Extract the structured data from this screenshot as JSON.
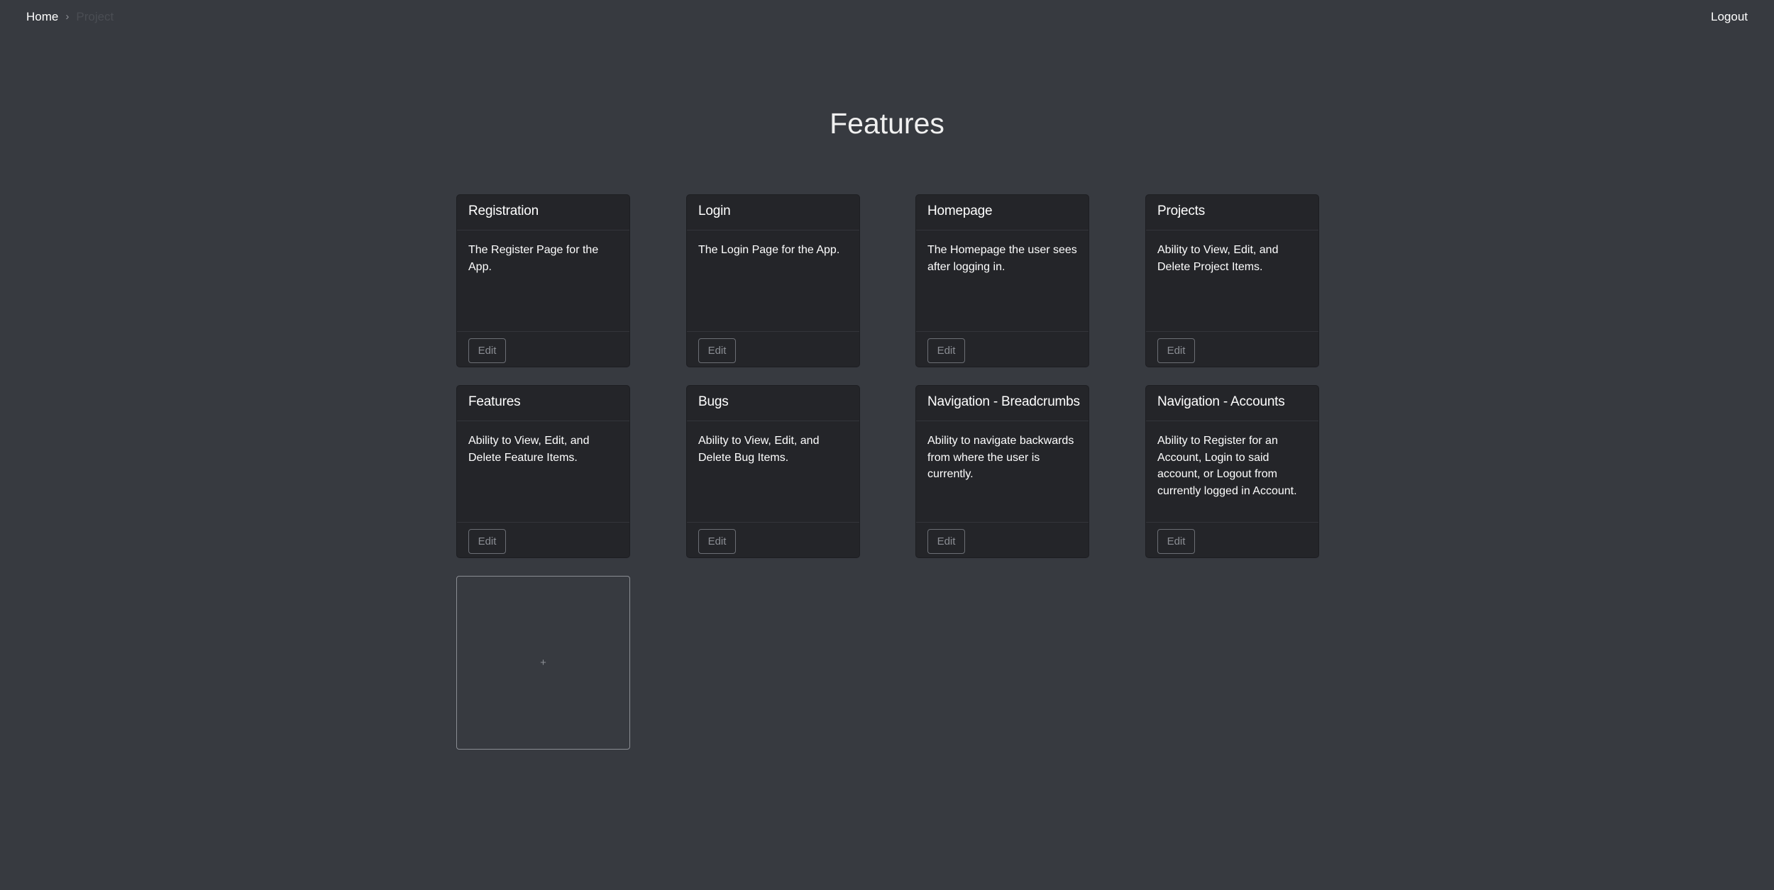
{
  "nav": {
    "breadcrumb": [
      {
        "label": "Home"
      },
      {
        "label": "Project"
      }
    ],
    "separator": "›",
    "logout_label": "Logout"
  },
  "page": {
    "title": "Features"
  },
  "features": [
    {
      "title": "Registration",
      "description": "The Register Page for the App.",
      "edit_label": "Edit"
    },
    {
      "title": "Login",
      "description": "The Login Page for the App.",
      "edit_label": "Edit"
    },
    {
      "title": "Homepage",
      "description": "The Homepage the user sees after logging in.",
      "edit_label": "Edit"
    },
    {
      "title": "Projects",
      "description": "Ability to View, Edit, and Delete Project Items.",
      "edit_label": "Edit"
    },
    {
      "title": "Features",
      "description": "Ability to View, Edit, and Delete Feature Items.",
      "edit_label": "Edit"
    },
    {
      "title": "Bugs",
      "description": "Ability to View, Edit, and Delete Bug Items.",
      "edit_label": "Edit"
    },
    {
      "title": "Navigation - Breadcrumbs",
      "description": "Ability to navigate backwards from where the user is currently.",
      "edit_label": "Edit"
    },
    {
      "title": "Navigation - Accounts",
      "description": "Ability to Register for an Account, Login to said account, or Logout from currently logged in Account.",
      "edit_label": "Edit"
    }
  ],
  "add_card": {
    "symbol": "+"
  }
}
